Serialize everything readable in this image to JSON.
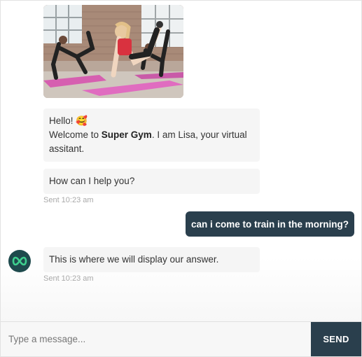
{
  "conversation": {
    "image": {
      "alt": "Women doing fitness exercises on pink mats in a gym"
    },
    "greeting": {
      "line1": "Hello!",
      "emoji": "🥰",
      "welcome_prefix": "Welcome to ",
      "gym_name": "Super Gym",
      "welcome_suffix": ". I am Lisa, your virtual assitant."
    },
    "help_prompt": "How can I help you?",
    "sent_time_1": "Sent 10:23 am",
    "user_message": "can i come to train in the morning?",
    "bot_answer": "This is where we will display our answer.",
    "sent_time_2": "Sent 10:23 am",
    "bot_avatar_icon": "infinity-logo-icon"
  },
  "composer": {
    "placeholder": "Type a message...",
    "send_label": "SEND"
  },
  "colors": {
    "accent": "#2a3f4d",
    "bubble_bg": "#f5f5f5",
    "avatar_bg": "#1e4a4d",
    "logo_green": "#3ecf8e"
  }
}
